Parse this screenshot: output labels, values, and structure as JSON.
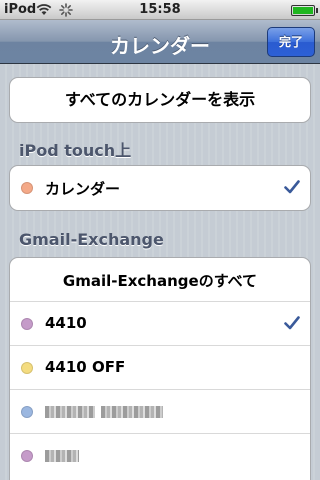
{
  "status": {
    "carrier": "iPod",
    "time": "15:58",
    "battery_level": 1.0
  },
  "nav": {
    "title": "カレンダー",
    "done_label": "完了"
  },
  "show_all": {
    "label": "すべてのカレンダーを表示"
  },
  "sections": {
    "ipod": {
      "header": "iPod touch上",
      "rows": [
        {
          "label": "カレンダー",
          "dot_color": "#f4a988",
          "checked": true
        }
      ]
    },
    "gmail": {
      "header": "Gmail-Exchange",
      "all_label": "Gmail-Exchangeのすべて",
      "rows": [
        {
          "label": "4410",
          "dot_color": "#c59bc9",
          "checked": true
        },
        {
          "label": "4410 OFF",
          "dot_color": "#f4dc80",
          "checked": false
        },
        {
          "label": "",
          "dot_color": "#9bb7e0",
          "checked": false,
          "redacted": true
        },
        {
          "label": "",
          "dot_color": "#c59bc9",
          "checked": false,
          "redacted": true
        }
      ]
    }
  },
  "colors": {
    "check": "#3a5a9a",
    "nav_tint": "#6d84a2",
    "done_button": "#2d60d6"
  },
  "icons": [
    "wifi-icon",
    "activity-icon",
    "battery-icon",
    "checkmark-icon"
  ]
}
